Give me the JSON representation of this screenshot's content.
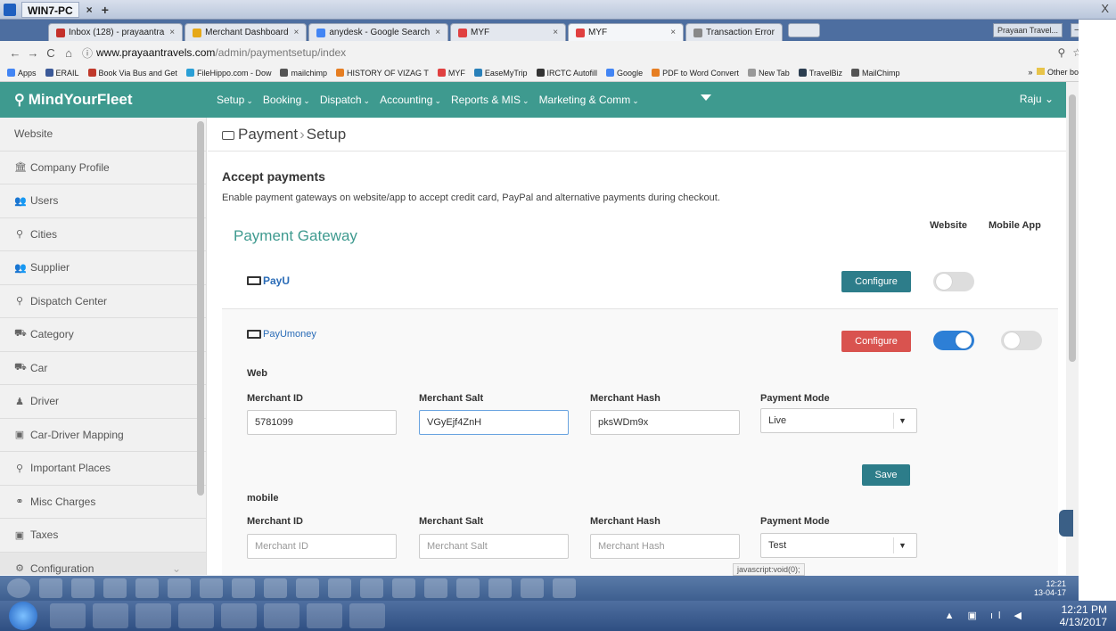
{
  "remote": {
    "title": "WIN7-PC",
    "close_x": "×",
    "plus": "+",
    "win_close": "X"
  },
  "browser": {
    "tabs": [
      {
        "label": "Inbox (128) - prayaantra",
        "color": "#c4302b"
      },
      {
        "label": "Merchant Dashboard",
        "color": "#e6a817"
      },
      {
        "label": "anydesk - Google Search",
        "color": "#4285f4"
      },
      {
        "label": "MYF",
        "color": "#e04040"
      },
      {
        "label": "MYF",
        "color": "#e04040",
        "active": true
      },
      {
        "label": "Transaction Error",
        "color": "#888888"
      }
    ],
    "profile_chip": "Prayaan Travel...",
    "url_host": "www.prayaantravels.com",
    "url_path": "/admin/paymentsetup/index",
    "bookmarks": [
      {
        "label": "Apps",
        "color": "#4285f4"
      },
      {
        "label": "ERAIL",
        "color": "#3b5998"
      },
      {
        "label": "Book Via Bus and Get",
        "color": "#c0392b"
      },
      {
        "label": "FileHippo.com - Dow",
        "color": "#2a9fd6"
      },
      {
        "label": "mailchimp",
        "color": "#555555"
      },
      {
        "label": "HISTORY OF VIZAG T",
        "color": "#e67e22"
      },
      {
        "label": "MYF",
        "color": "#e04040"
      },
      {
        "label": "EaseMyTrip",
        "color": "#2980b9"
      },
      {
        "label": "IRCTC Autofill",
        "color": "#333333"
      },
      {
        "label": "Google",
        "color": "#4285f4"
      },
      {
        "label": "PDF to Word Convert",
        "color": "#e67e22"
      },
      {
        "label": "New Tab",
        "color": "#999999"
      },
      {
        "label": "TravelBiz",
        "color": "#2c3e50"
      },
      {
        "label": "MailChimp",
        "color": "#555555"
      }
    ],
    "bookmarks_more": "»",
    "other_bookmarks": "Other bookmarks"
  },
  "app": {
    "logo": "MindYourFleet",
    "menu": [
      "Setup",
      "Booking",
      "Dispatch",
      "Accounting",
      "Reports & MIS",
      "Marketing & Comm"
    ],
    "user": "Raju"
  },
  "sidebar": [
    {
      "label": "Website",
      "icon": ""
    },
    {
      "label": "Company Profile",
      "icon": "🏛"
    },
    {
      "label": "Users",
      "icon": "👥"
    },
    {
      "label": "Cities",
      "icon": "⚲"
    },
    {
      "label": "Supplier",
      "icon": "👥"
    },
    {
      "label": "Dispatch Center",
      "icon": "⚲"
    },
    {
      "label": "Category",
      "icon": "⛟"
    },
    {
      "label": "Car",
      "icon": "⛟"
    },
    {
      "label": "Driver",
      "icon": "♟"
    },
    {
      "label": "Car-Driver Mapping",
      "icon": "▣"
    },
    {
      "label": "Important Places",
      "icon": "⚲"
    },
    {
      "label": "Misc Charges",
      "icon": "⚭"
    },
    {
      "label": "Taxes",
      "icon": "▣"
    },
    {
      "label": "Configuration",
      "icon": "⚙"
    }
  ],
  "page": {
    "breadcrumb": {
      "section": "Payment",
      "sep": "›",
      "page": "Setup"
    },
    "accept_title": "Accept payments",
    "accept_desc": "Enable payment gateways on website/app to accept credit card, PayPal and alternative payments during checkout.",
    "col_website": "Website",
    "col_mobile": "Mobile App",
    "gateway_title": "Payment Gateway",
    "payu": {
      "logo": "PayU",
      "configure": "Configure",
      "website_on": false
    },
    "payumoney": {
      "logo": "PayUmoney",
      "configure": "Configure",
      "website_on": true,
      "mobile_on": false
    },
    "web": {
      "heading": "Web",
      "merchant_id_label": "Merchant ID",
      "merchant_salt_label": "Merchant Salt",
      "merchant_hash_label": "Merchant Hash",
      "payment_mode_label": "Payment Mode",
      "merchant_id": "5781099",
      "merchant_salt": "VGyEjf4ZnH",
      "merchant_hash": "pksWDm9x",
      "payment_mode": "Live",
      "save": "Save"
    },
    "mobile": {
      "heading": "mobile",
      "merchant_id_label": "Merchant ID",
      "merchant_salt_label": "Merchant Salt",
      "merchant_hash_label": "Merchant Hash",
      "payment_mode_label": "Payment Mode",
      "merchant_id_ph": "Merchant ID",
      "merchant_salt_ph": "Merchant Salt",
      "merchant_hash_ph": "Merchant Hash",
      "payment_mode": "Test"
    },
    "status_tip": "javascript:void(0);"
  },
  "taskbar": {
    "tray_time_small": "12:21",
    "tray_date_small": "13-04-17",
    "time": "12:21 PM",
    "date": "4/13/2017"
  }
}
